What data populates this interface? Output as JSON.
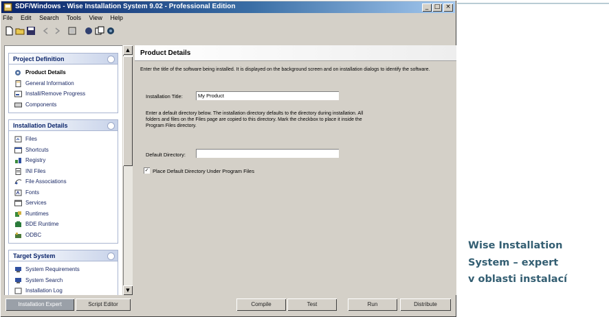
{
  "window": {
    "title": "SDF/Windows - Wise Installation System 9.02 - Professional Edition",
    "controls": {
      "minimize": "_",
      "maximize": "□",
      "close": "×"
    }
  },
  "menu": [
    "File",
    "Edit",
    "Search",
    "Tools",
    "View",
    "Help"
  ],
  "toolbar": [
    "new-icon",
    "open-icon",
    "save-icon",
    "back-icon",
    "forward-icon",
    "compile-icon",
    "test-icon",
    "copy-icon",
    "help-icon"
  ],
  "sidebar": {
    "groups": [
      {
        "title": "Project Definition",
        "items": [
          {
            "label": "Product Details",
            "icon": "product-icon",
            "selected": true
          },
          {
            "label": "General Information",
            "icon": "document-icon"
          },
          {
            "label": "Install/Remove Progress",
            "icon": "progress-icon"
          },
          {
            "label": "Components",
            "icon": "components-icon"
          }
        ]
      },
      {
        "title": "Installation Details",
        "items": [
          {
            "label": "Files",
            "icon": "files-icon"
          },
          {
            "label": "Shortcuts",
            "icon": "shortcut-icon"
          },
          {
            "label": "Registry",
            "icon": "registry-icon"
          },
          {
            "label": "INI Files",
            "icon": "ini-icon"
          },
          {
            "label": "File Associations",
            "icon": "association-icon"
          },
          {
            "label": "Fonts",
            "icon": "fonts-icon"
          },
          {
            "label": "Services",
            "icon": "services-icon"
          },
          {
            "label": "Runtimes",
            "icon": "runtimes-icon"
          },
          {
            "label": "BDE Runtime",
            "icon": "bde-icon"
          },
          {
            "label": "ODBC",
            "icon": "odbc-icon"
          }
        ]
      },
      {
        "title": "Target System",
        "items": [
          {
            "label": "System Requirements",
            "icon": "system-icon"
          },
          {
            "label": "System Search",
            "icon": "search-icon"
          },
          {
            "label": "Installation Log",
            "icon": "log-icon"
          }
        ]
      }
    ]
  },
  "content": {
    "title": "Product Details",
    "intro": "Enter the title of the software being installed. It is displayed on the background screen and on installation dialogs to identify the software.",
    "title_label": "Installation Title:",
    "title_value": "My Product",
    "dir_paragraph": "Enter a default directory below. The installation directory defaults to the directory during installation. All folders and files on the Files page are copied to this directory. Mark the checkbox to place it inside the Program Files directory.",
    "dir_label": "Default Directory:",
    "dir_value": "",
    "checkbox_label": "Place Default Directory Under Program Files",
    "checkbox_checked": true
  },
  "bottom": {
    "tabs": [
      "Installation Expert",
      "Script Editor"
    ],
    "buttons": [
      "Compile",
      "Test",
      "Run",
      "Distribute"
    ]
  },
  "caption": {
    "lines": [
      "Wise Installation",
      "System – expert",
      "v oblasti instalací"
    ],
    "color": "#335e72"
  },
  "colors": {
    "titlebar": "#0a246a",
    "accent_rule": "#b9ccd4"
  }
}
